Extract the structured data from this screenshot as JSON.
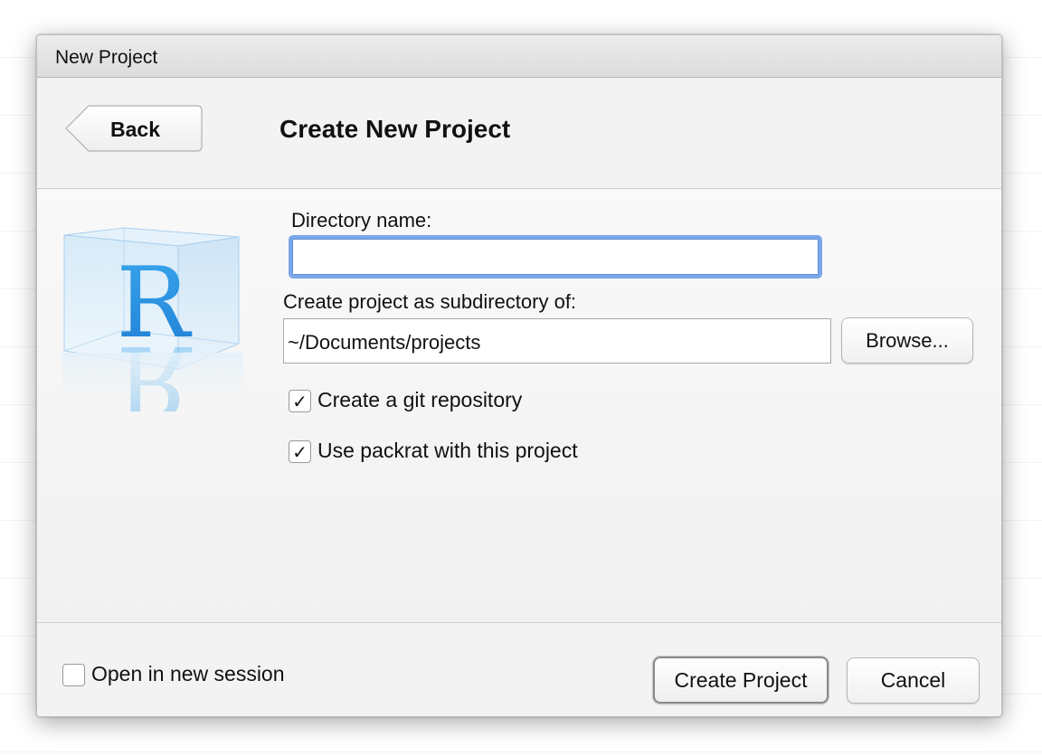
{
  "window": {
    "title": "New Project"
  },
  "header": {
    "back_label": "Back",
    "page_title": "Create New Project"
  },
  "form": {
    "directory_name_label": "Directory name:",
    "directory_name_value": "",
    "subdirectory_label": "Create project as subdirectory of:",
    "subdirectory_value": "~/Documents/projects",
    "browse_label": "Browse...",
    "git_label": "Create a git repository",
    "git_checked": true,
    "packrat_label": "Use packrat with this project",
    "packrat_checked": true
  },
  "footer": {
    "session_label": "Open in new session",
    "session_checked": false,
    "create_label": "Create Project",
    "cancel_label": "Cancel"
  },
  "icons": {
    "logo": "r-cube-logo",
    "back": "back-arrow-shape",
    "check": "checkmark"
  },
  "colors": {
    "focus_ring": "#7aa7e8",
    "logo_blue": "#2b8fe0",
    "dialog_bg": "#f3f3f3"
  }
}
